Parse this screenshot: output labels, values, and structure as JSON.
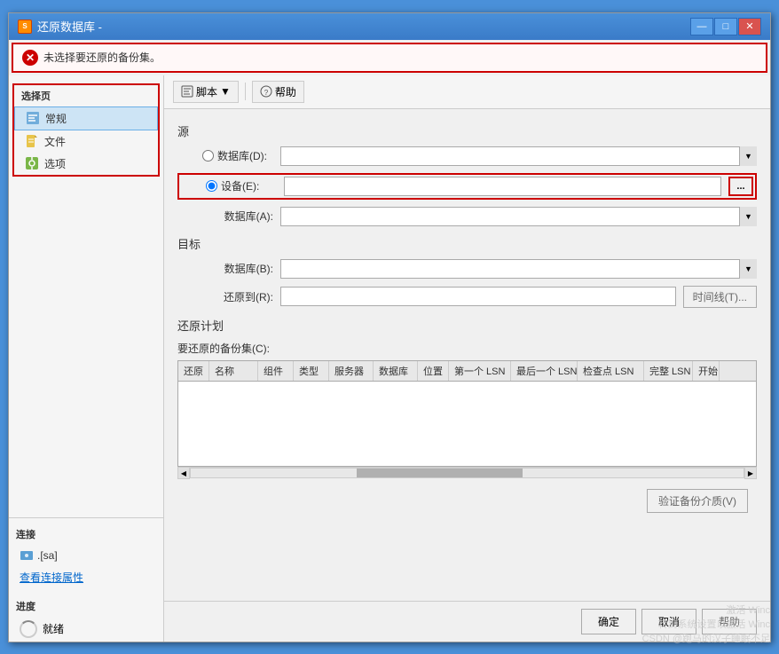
{
  "dialog": {
    "title": "还原数据库 -",
    "title_icon": "DB",
    "error_message": "未选择要还原的备份集。",
    "toolbar": {
      "script_label": "脚本",
      "script_arrow": "▼",
      "help_label": "帮助"
    },
    "sidebar": {
      "section_label": "选择页",
      "items": [
        {
          "label": "常规",
          "active": true
        },
        {
          "label": "文件"
        },
        {
          "label": "选项"
        }
      ],
      "connection_section": "连接",
      "connection_user": ".[sa]",
      "link_label": "查看连接属性",
      "progress_section": "进度",
      "progress_status": "就绪"
    },
    "source_section": "源",
    "database_source_label": "数据库(D):",
    "device_source_label": "设备(E):",
    "database_a_label": "数据库(A):",
    "target_section": "目标",
    "target_database_label": "数据库(B):",
    "restore_to_label": "还原到(R):",
    "timeline_btn": "时间线(T)...",
    "plan_section": "还原计划",
    "backup_sets_label": "要还原的备份集(C):",
    "table_columns": [
      "还原",
      "名称",
      "组件",
      "类型",
      "服务器",
      "数据库",
      "位置",
      "第一个 LSN",
      "最后一个 LSN",
      "检查点 LSN",
      "完整 LSN",
      "开始"
    ],
    "validate_btn": "验证备份介质(V)",
    "browse_btn": "...",
    "ok_btn": "确定",
    "cancel_btn": "取消",
    "help_btn": "帮助",
    "window_controls": {
      "minimize": "—",
      "maximize": "□",
      "close": "✕"
    }
  },
  "watermark": {
    "line1": "激活 Winc",
    "line2": "转到系统设置以激活 Winc",
    "line3": "CSDN @跑马的汉子睡眠不足"
  }
}
